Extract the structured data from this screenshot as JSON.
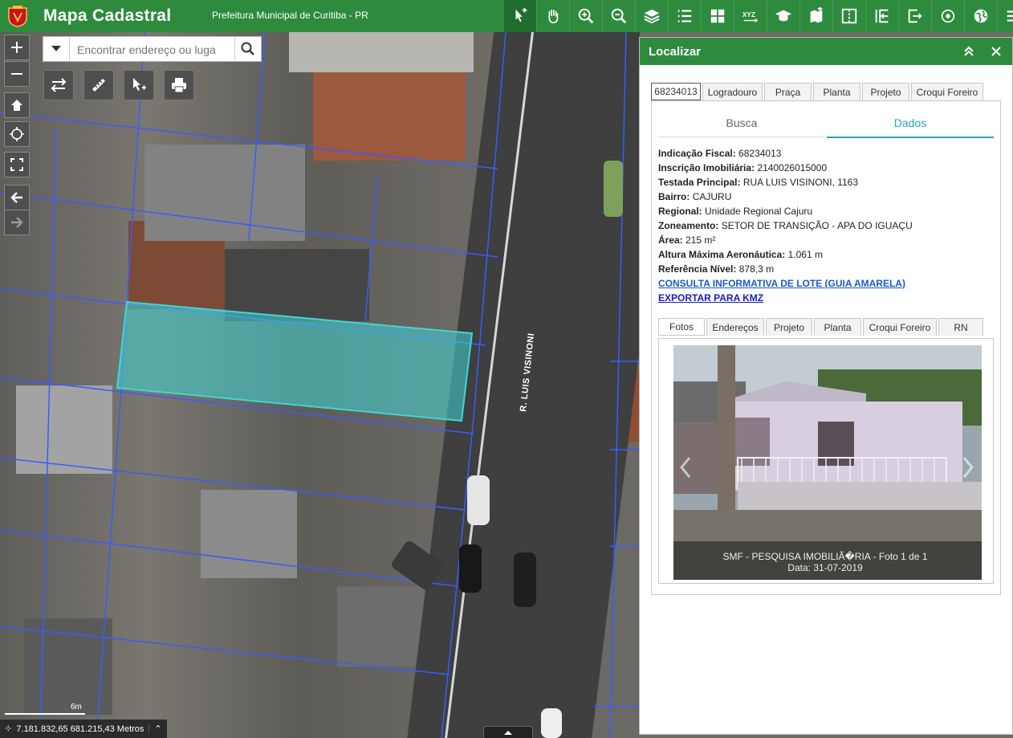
{
  "header": {
    "title": "Mapa Cadastral",
    "subtitle": "Prefeitura Municipal de Curitiba - PR",
    "tools": [
      {
        "icon": "identify-icon",
        "active": true
      },
      {
        "icon": "pan-hand-icon"
      },
      {
        "icon": "zoom-in-icon"
      },
      {
        "icon": "zoom-out-icon"
      },
      {
        "icon": "layers-icon"
      },
      {
        "icon": "list-icon"
      },
      {
        "icon": "grid-icon"
      },
      {
        "icon": "xyz-coordinates-icon"
      },
      {
        "icon": "graduation-icon"
      },
      {
        "icon": "add-map-icon"
      },
      {
        "icon": "split-screen-icon"
      },
      {
        "icon": "import-icon"
      },
      {
        "icon": "export-icon"
      },
      {
        "icon": "target-icon"
      },
      {
        "icon": "globe-icon"
      },
      {
        "icon": "menu-icon"
      }
    ],
    "xyz_label": "XYZ"
  },
  "map": {
    "search_placeholder": "Encontrar endereço ou luga",
    "street_label": "R. LUIS VISINONI",
    "scale_label": "6m",
    "coordinates": "7.181.832,65 681.215,43 Metros"
  },
  "panel": {
    "title": "Localizar",
    "top_tabs": [
      "68234013",
      "Logradouro",
      "Praça",
      "Planta",
      "Projeto",
      "Croqui Foreiro"
    ],
    "sub_tabs": {
      "busca": "Busca",
      "dados": "Dados"
    },
    "fields": [
      {
        "label": "Indicação Fiscal:",
        "value": "68234013"
      },
      {
        "label": "Inscrição Imobiliária:",
        "value": "2140026015000"
      },
      {
        "label": "Testada Principal:",
        "value": "RUA LUIS VISINONI, 1163"
      },
      {
        "label": "Bairro:",
        "value": "CAJURU"
      },
      {
        "label": "Regional:",
        "value": "Unidade Regional Cajuru"
      },
      {
        "label": "Zoneamento:",
        "value": "SETOR DE TRANSIÇÃO - APA DO IGUAÇU"
      },
      {
        "label": "Área:",
        "value": "215 m²"
      },
      {
        "label": "Altura Máxima Aeronáutica:",
        "value": "1.061 m"
      },
      {
        "label": "Referência Nível:",
        "value": "878,3 m"
      }
    ],
    "link_guia": "CONSULTA INFORMATIVA DE LOTE (GUIA AMARELA)",
    "link_kmz": "EXPORTAR PARA KMZ",
    "photo_tabs": [
      "Fotos",
      "Endereços",
      "Projeto",
      "Planta",
      "Croqui Foreiro",
      "RN"
    ],
    "photo_caption_1": "SMF - PESQUISA IMOBILIÃ�RIA - Foto 1 de 1",
    "photo_caption_2": "Data: 31-07-2019"
  },
  "colors": {
    "brand_green": "#2e8b3e",
    "accent_teal": "#27a3b8",
    "parcel_highlight": "#3fd6d6",
    "link_blue": "#1a5bc4"
  }
}
